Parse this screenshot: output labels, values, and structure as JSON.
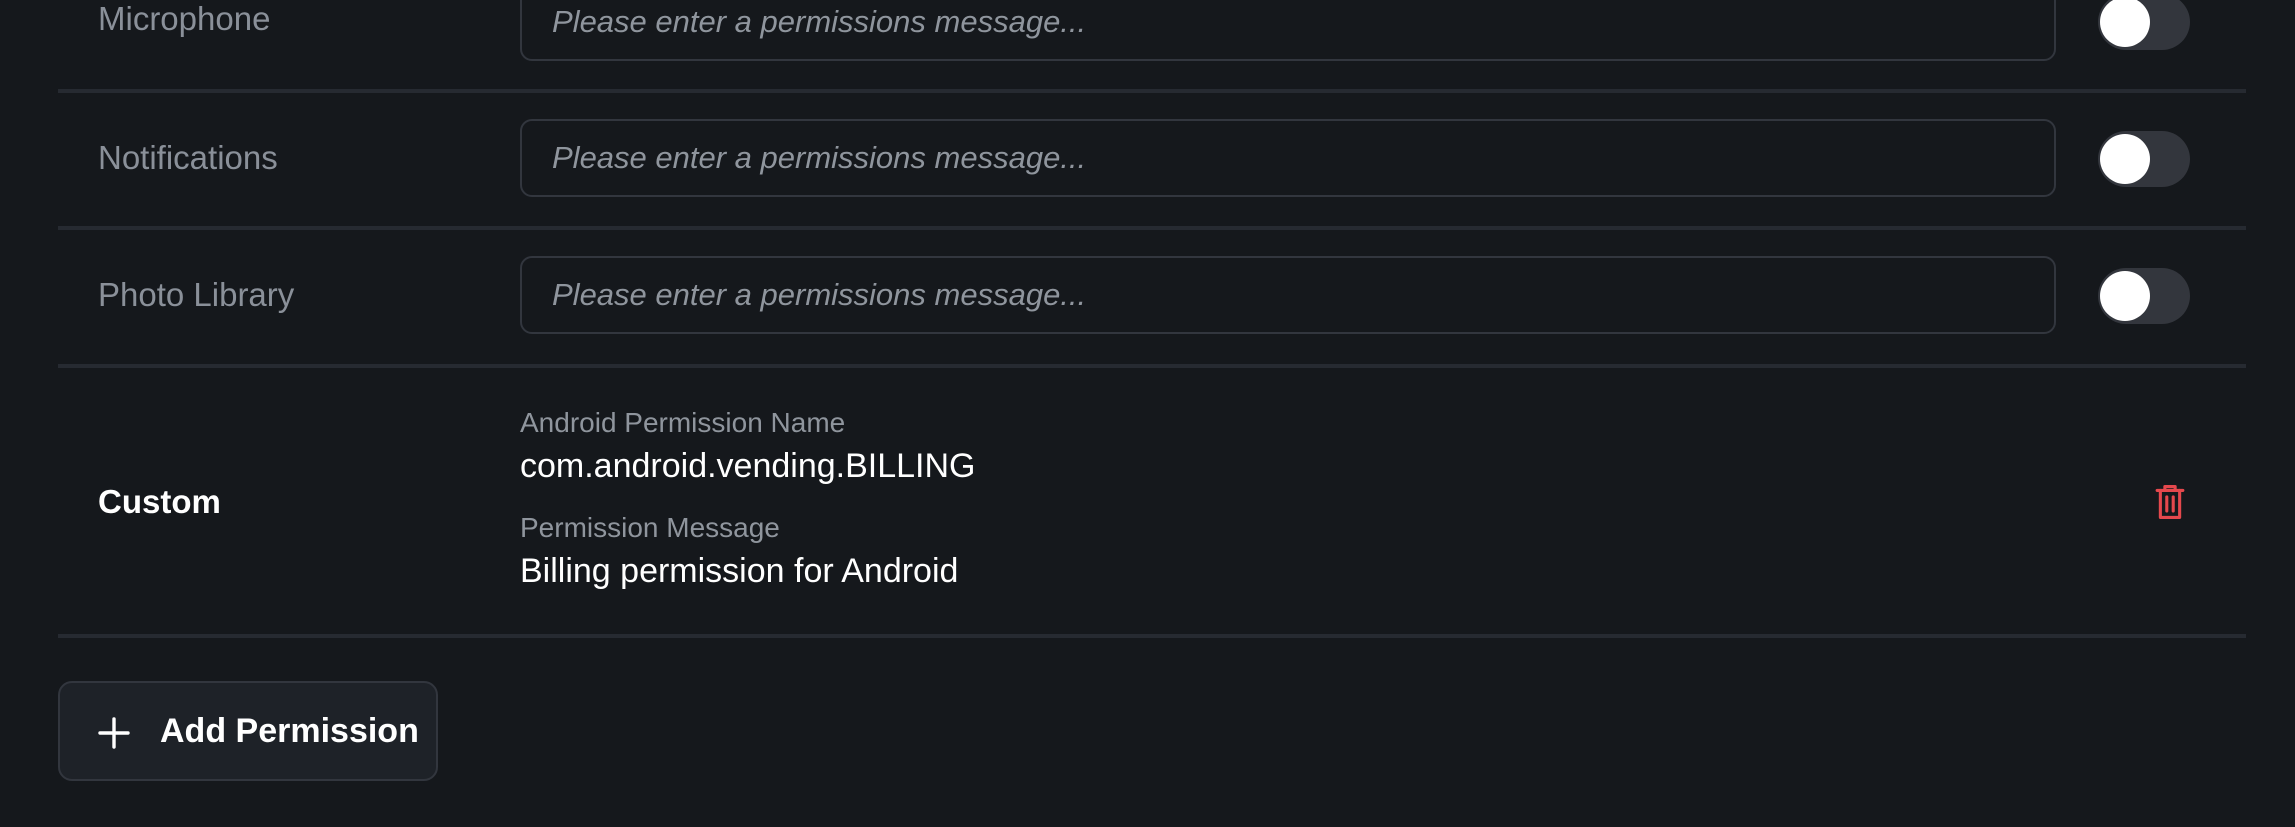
{
  "permissions": [
    {
      "label": "Microphone",
      "placeholder": "Please enter a permissions message...",
      "enabled": false
    },
    {
      "label": "Notifications",
      "placeholder": "Please enter a permissions message...",
      "enabled": false
    },
    {
      "label": "Photo Library",
      "placeholder": "Please enter a permissions message...",
      "enabled": false
    }
  ],
  "custom": {
    "title": "Custom",
    "name_caption": "Android Permission Name",
    "name_value": "com.android.vending.BILLING",
    "message_caption": "Permission Message",
    "message_value": "Billing permission for Android",
    "delete_icon": "trash-icon",
    "delete_color": "#e5484d"
  },
  "add_button": {
    "label": "Add Permission",
    "icon": "plus-icon"
  }
}
